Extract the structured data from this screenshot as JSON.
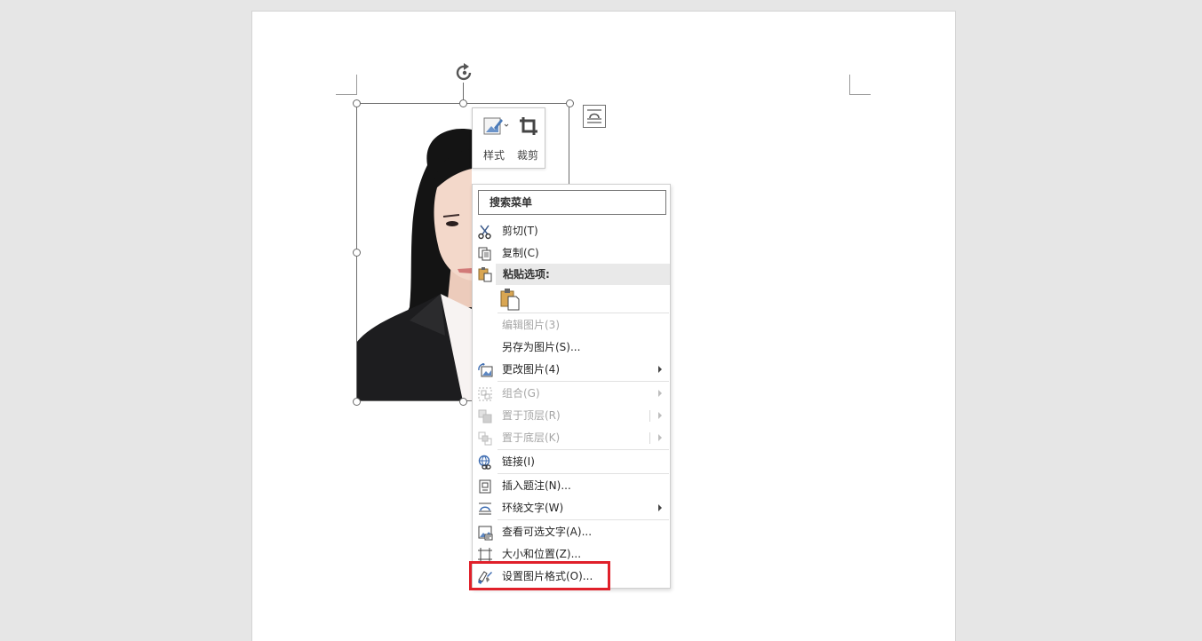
{
  "mini_toolbar": {
    "style_label": "样式",
    "crop_label": "裁剪"
  },
  "context_menu": {
    "search_placeholder": "搜索菜单",
    "items": [
      {
        "label": "剪切(T)",
        "icon": "scissors-icon",
        "enabled": true
      },
      {
        "label": "复制(C)",
        "icon": "copy-icon",
        "enabled": true
      },
      {
        "label": "粘贴选项:",
        "icon": "paste-icon",
        "enabled": true
      },
      {
        "label": "编辑图片(3)",
        "icon": "",
        "enabled": false
      },
      {
        "label": "另存为图片(S)...",
        "icon": "",
        "enabled": true
      },
      {
        "label": "更改图片(4)",
        "icon": "change-picture-icon",
        "enabled": true,
        "submenu": true
      },
      {
        "label": "组合(G)",
        "icon": "group-icon",
        "enabled": false,
        "submenu": true
      },
      {
        "label": "置于顶层(R)",
        "icon": "bring-to-front-icon",
        "enabled": false,
        "submenu": true
      },
      {
        "label": "置于底层(K)",
        "icon": "send-to-back-icon",
        "enabled": false,
        "submenu": true
      },
      {
        "label": "链接(I)",
        "icon": "link-icon",
        "enabled": true
      },
      {
        "label": "插入题注(N)...",
        "icon": "insert-caption-icon",
        "enabled": true
      },
      {
        "label": "环绕文字(W)",
        "icon": "wrap-text-icon",
        "enabled": true,
        "submenu": true
      },
      {
        "label": "查看可选文字(A)...",
        "icon": "alt-text-icon",
        "enabled": true
      },
      {
        "label": "大小和位置(Z)...",
        "icon": "size-position-icon",
        "enabled": true
      },
      {
        "label": "设置图片格式(O)...",
        "icon": "format-picture-icon",
        "enabled": true,
        "highlighted": true
      }
    ]
  },
  "colors": {
    "highlight": "#e0202a",
    "page_bg": "#e6e6e6",
    "suit": "#1d1d1f",
    "hair": "#141414",
    "skin": "#f2d6c8"
  }
}
